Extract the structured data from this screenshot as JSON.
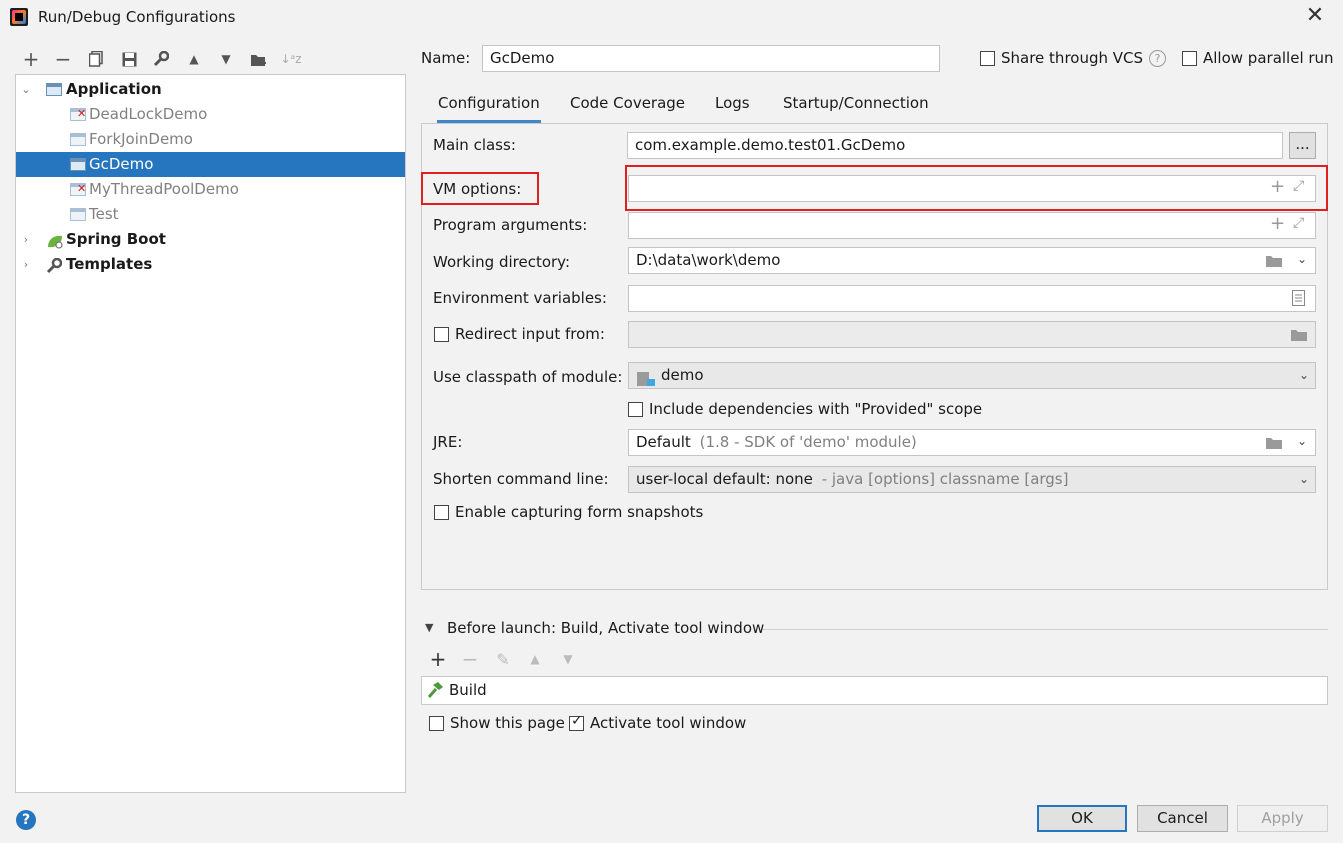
{
  "window": {
    "title": "Run/Debug Configurations",
    "close_icon": "close-icon"
  },
  "toolbar": {
    "icons": [
      "add-icon",
      "remove-icon",
      "copy-icon",
      "save-icon",
      "wrench-icon",
      "move-up-icon",
      "move-down-icon",
      "new-folder-icon",
      "sort-alpha-icon"
    ]
  },
  "tree": {
    "application": "Application",
    "items": [
      "DeadLockDemo",
      "ForkJoinDemo",
      "GcDemo",
      "MyThreadPoolDemo",
      "Test"
    ],
    "spring_boot": "Spring Boot",
    "templates": "Templates",
    "selected": "GcDemo"
  },
  "header": {
    "name_label": "Name:",
    "name_value": "GcDemo",
    "share_vcs": "Share through VCS",
    "help": "?",
    "allow_parallel": "Allow parallel run"
  },
  "tabs": [
    "Configuration",
    "Code Coverage",
    "Logs",
    "Startup/Connection"
  ],
  "form": {
    "main_class_label": "Main class:",
    "main_class_value": "com.example.demo.test01.GcDemo",
    "browse_label": "...",
    "vm_options_label": "VM options:",
    "vm_options_value": "",
    "program_args_label": "Program arguments:",
    "program_args_value": "",
    "working_dir_label": "Working directory:",
    "working_dir_value": "D:\\data\\work\\demo",
    "env_vars_label": "Environment variables:",
    "env_vars_value": "",
    "redirect_label": "Redirect input from:",
    "classpath_label": "Use classpath of module:",
    "classpath_value": "demo",
    "include_deps_label": "Include dependencies with \"Provided\" scope",
    "jre_label": "JRE:",
    "jre_value": "Default",
    "jre_hint": "(1.8 - SDK of 'demo' module)",
    "shorten_label": "Shorten command line:",
    "shorten_value": "user-local default: none",
    "shorten_hint": "- java [options] classname [args]",
    "snapshots_label": "Enable capturing form snapshots"
  },
  "before_launch": {
    "title": "Before launch: Build, Activate tool window",
    "item": "Build",
    "show_page": "Show this page",
    "activate_tool": "Activate tool window"
  },
  "buttons": {
    "ok": "OK",
    "cancel": "Cancel",
    "apply": "Apply",
    "help": "?"
  },
  "colors": {
    "selection": "#2675bf",
    "highlight_box": "#e02020",
    "error_mark": "#d21d1d"
  }
}
